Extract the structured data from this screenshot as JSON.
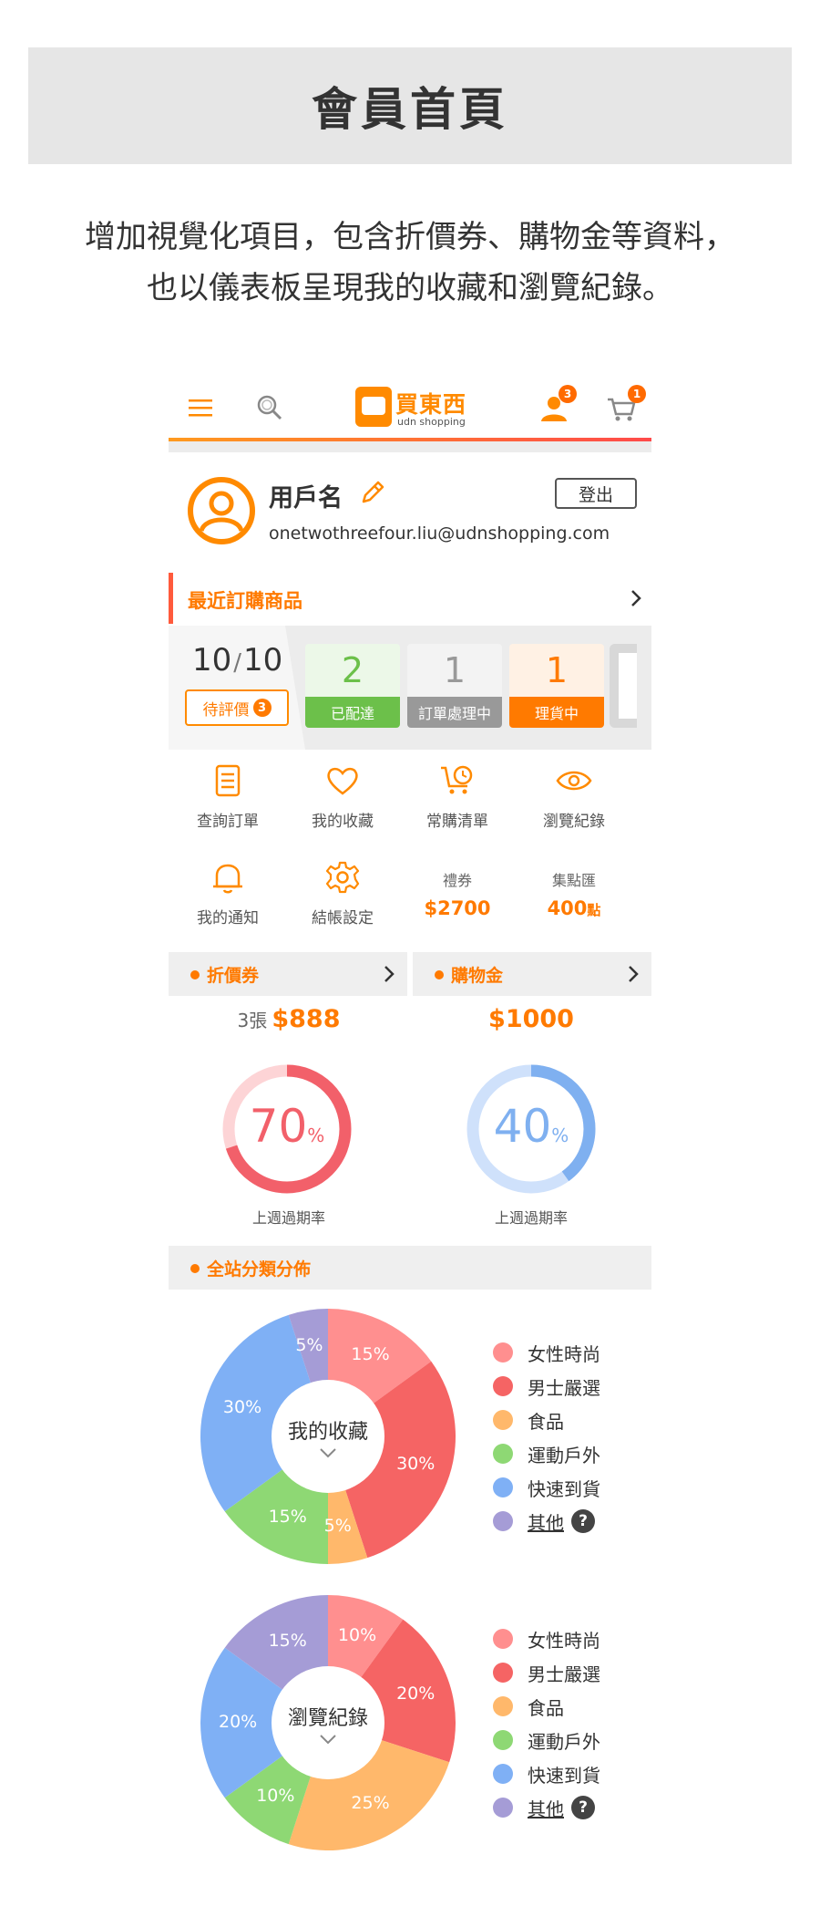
{
  "header": {
    "title": "會員首頁",
    "desc_line1": "增加視覺化項目，包含折價券、購物金等資料，",
    "desc_line2": "也以儀表板呈現我的收藏和瀏覽紀錄。"
  },
  "topbar": {
    "logo_name": "買東西",
    "logo_sub": "udn shopping",
    "member_badge": "3",
    "cart_badge": "1",
    "accent": "#ff8a00"
  },
  "user": {
    "name": "用戶名",
    "email": "onetwothreefour.liu@udnshopping.com",
    "logout_label": "登出"
  },
  "recent_orders": {
    "title": "最近訂購商品",
    "count": "10",
    "total": "10",
    "pending_label": "待評價",
    "pending_count": "3",
    "cards": [
      {
        "num": "2",
        "label": "已配達",
        "color": "#6cc04a"
      },
      {
        "num": "1",
        "label": "訂單處理中",
        "color": "#999999"
      },
      {
        "num": "1",
        "label": "理貨中",
        "color": "#ff7a00"
      }
    ]
  },
  "menu": {
    "items": [
      {
        "label": "查詢訂單",
        "icon": "order-list-icon"
      },
      {
        "label": "我的收藏",
        "icon": "heart-icon"
      },
      {
        "label": "常購清單",
        "icon": "cart-clock-icon"
      },
      {
        "label": "瀏覽紀錄",
        "icon": "eye-icon"
      },
      {
        "label": "我的通知",
        "icon": "bell-icon"
      },
      {
        "label": "結帳設定",
        "icon": "gear-icon"
      }
    ],
    "voucher_label": "禮券",
    "voucher_value": "$2700",
    "points_label": "集點匯",
    "points_value": "400",
    "points_unit": "點"
  },
  "coupons": {
    "title": "折價券",
    "qty": "3張",
    "value": "$888",
    "rate": 70,
    "rate_unit": "%",
    "caption": "上週過期率",
    "color": "#f2606a"
  },
  "credit": {
    "title": "購物金",
    "value": "$1000",
    "rate": 40,
    "rate_unit": "%",
    "caption": "上週過期率",
    "color": "#7fb0f0"
  },
  "distribution": {
    "title": "全站分類分佈",
    "legend": [
      "女性時尚",
      "男士嚴選",
      "食品",
      "運動戶外",
      "快速到貨",
      "其他"
    ],
    "colors": [
      "#ff8f8f",
      "#f56464",
      "#ffb86b",
      "#8ed874",
      "#7fb0f5",
      "#a59cd6"
    ],
    "help_label": "?"
  },
  "chart_data": [
    {
      "type": "pie",
      "title": "我的收藏",
      "categories": [
        "女性時尚",
        "男士嚴選",
        "食品",
        "運動戶外",
        "快速到貨",
        "其他"
      ],
      "values": [
        15,
        30,
        5,
        15,
        30,
        5
      ],
      "labels": [
        "15%",
        "30%",
        "5%",
        "15%",
        "30%",
        "5%"
      ]
    },
    {
      "type": "pie",
      "title": "瀏覽紀錄",
      "categories": [
        "女性時尚",
        "男士嚴選",
        "食品",
        "運動戶外",
        "快速到貨",
        "其他"
      ],
      "values": [
        10,
        20,
        25,
        10,
        20,
        15
      ],
      "labels": [
        "10%",
        "20%",
        "25%",
        "10%",
        "20%",
        "15%"
      ]
    }
  ]
}
